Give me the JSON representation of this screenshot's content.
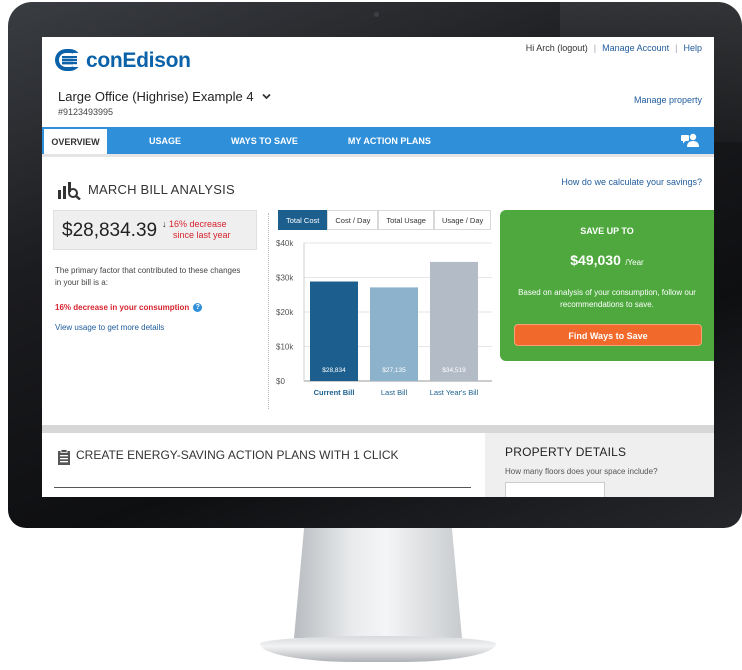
{
  "brand": {
    "name": "conEdison",
    "primary_color": "#0b62a8",
    "accent_blue": "#2f8fd8",
    "green": "#4ea83e",
    "orange": "#f26a2b"
  },
  "header": {
    "greeting": "Hi Arch (logout)",
    "manage_account": "Manage Account",
    "help": "Help",
    "property_name": "Large Office (Highrise) Example 4",
    "property_id": "#9123493995",
    "manage_property": "Manage property"
  },
  "nav": {
    "tabs": [
      {
        "label": "OVERVIEW",
        "active": true
      },
      {
        "label": "USAGE",
        "active": false
      },
      {
        "label": "WAYS TO SAVE",
        "active": false
      },
      {
        "label": "MY ACTION PLANS",
        "active": false
      }
    ],
    "user_icon": "users-icon"
  },
  "analysis": {
    "title": "MARCH BILL ANALYSIS",
    "calc_link": "How do we calculate your savings?",
    "bill_amount": "$28,834.39",
    "change_line1": "16% decrease",
    "change_line2": "since last year",
    "factor_text": "The primary factor that contributed to these changes in your bill is a:",
    "decrease_text": "16% decrease in your consumption",
    "view_usage": "View usage to get more details"
  },
  "chart_tabs": [
    {
      "label": "Total Cost",
      "active": true
    },
    {
      "label": "Cost / Day",
      "active": false
    },
    {
      "label": "Total Usage",
      "active": false
    },
    {
      "label": "Usage / Day",
      "active": false
    }
  ],
  "chart_data": {
    "type": "bar",
    "categories": [
      "Current Bill",
      "Last Bill",
      "Last Year's Bill"
    ],
    "values": [
      28834,
      27135,
      34519
    ],
    "bar_labels": [
      "$28,834",
      "$27,135",
      "$34,519"
    ],
    "bar_colors": [
      "#1c5f8e",
      "#8db3cc",
      "#b3bcc6"
    ],
    "yticks": [
      0,
      10000,
      20000,
      30000,
      40000
    ],
    "ytick_labels": [
      "$0",
      "$10k",
      "$20k",
      "$30k",
      "$40k"
    ],
    "ylim": [
      0,
      40000
    ],
    "title": "",
    "xlabel": "",
    "ylabel": ""
  },
  "savings": {
    "heading": "SAVE UP TO",
    "amount": "$49,030",
    "per": "/Year",
    "description": "Based on analysis of your consumption, follow our recommendations to save.",
    "button": "Find Ways to Save"
  },
  "action_plans": {
    "title": "CREATE ENERGY-SAVING ACTION PLANS WITH 1 CLICK"
  },
  "property_details": {
    "title": "PROPERTY DETAILS",
    "question": "How many floors does your space include?",
    "input_value": ""
  }
}
